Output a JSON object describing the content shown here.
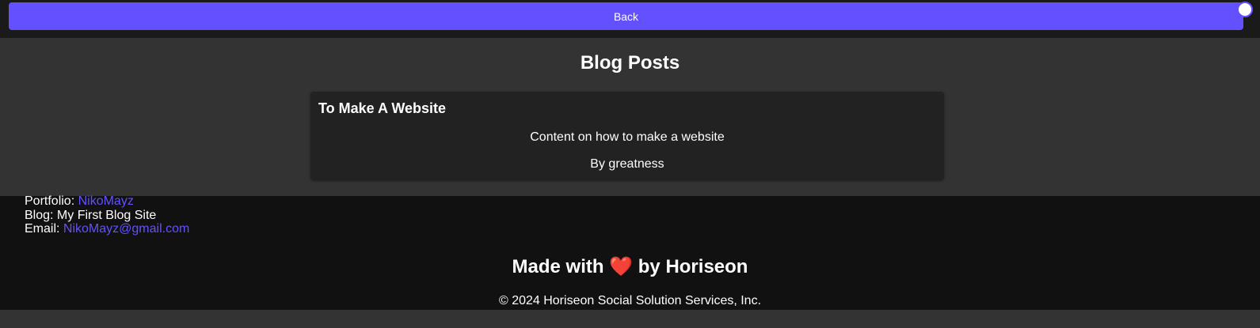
{
  "header": {
    "back_label": "Back"
  },
  "main": {
    "title": "Blog Posts",
    "posts": [
      {
        "title": "To Make A Website",
        "content": "Content on how to make a website",
        "author": "By greatness"
      }
    ]
  },
  "footer": {
    "portfolio_label": "Portfolio:",
    "portfolio_link": "NikoMayz",
    "blog_label": "Blog:",
    "blog_value": "My First Blog Site",
    "email_label": "Email:",
    "email_link": "NikoMayz@gmail.com",
    "made_with_prefix": "Made with",
    "heart": "❤️",
    "made_with_suffix": "by Horiseon",
    "copyright": "© 2024 Horiseon Social Solution Services, Inc."
  },
  "colors": {
    "accent": "#6350ff",
    "background": "#333333",
    "footer_bg": "#111111",
    "card_bg": "#222222"
  },
  "icons": {
    "theme_toggle": "toggle-circle-icon",
    "heart": "heart-icon"
  }
}
